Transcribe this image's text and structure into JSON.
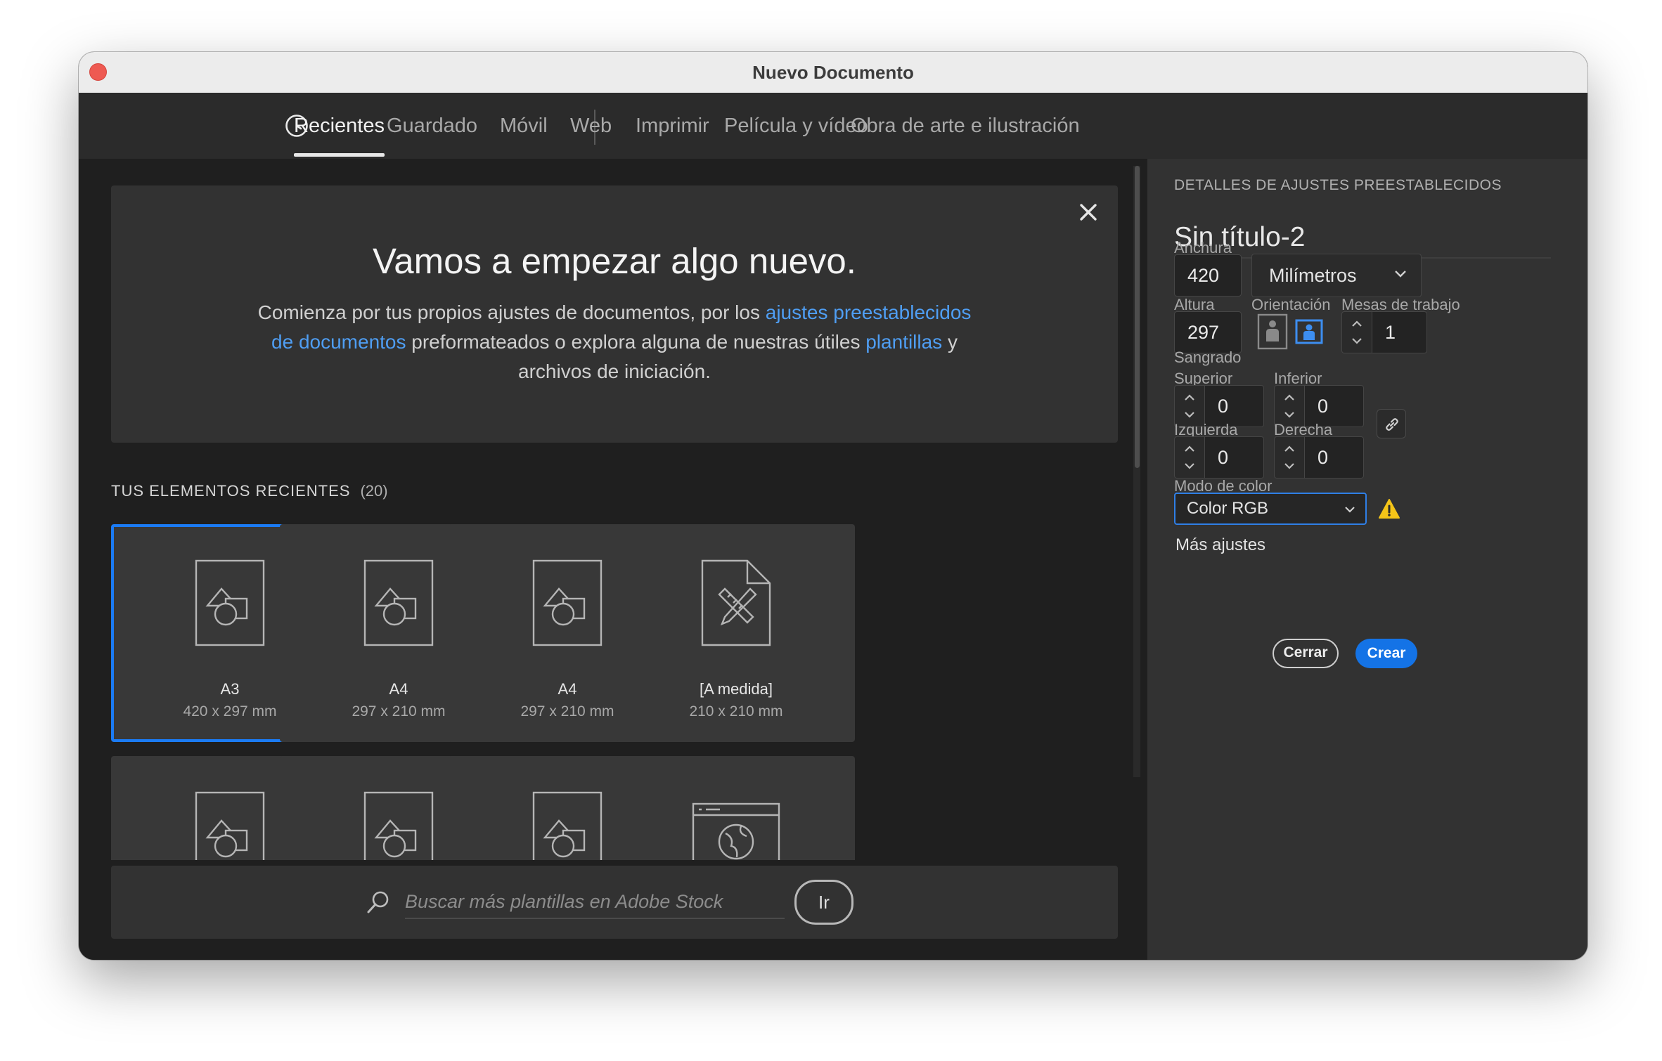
{
  "window": {
    "title": "Nuevo Documento"
  },
  "tabs": [
    {
      "label": "Recientes",
      "active": true
    },
    {
      "label": "Guardado"
    },
    {
      "label": "Móvil"
    },
    {
      "label": "Web"
    },
    {
      "label": "Imprimir"
    },
    {
      "label": "Película y vídeo"
    },
    {
      "label": "Obra de arte e ilustración"
    }
  ],
  "welcome": {
    "title": "Vamos a empezar algo nuevo.",
    "text_1": "Comienza por tus propios ajustes de documentos, por los ",
    "link_presets": "ajustes preestablecidos de documentos",
    "text_2": " preformateados o explora alguna de nuestras útiles ",
    "link_templates": "plantillas",
    "text_3": " y archivos de iniciación."
  },
  "recent": {
    "label": "TUS ELEMENTOS RECIENTES",
    "count": "(20)",
    "items": [
      {
        "name": "A3",
        "size": "420 x 297 mm",
        "icon": "shapes-document-icon",
        "selected": true
      },
      {
        "name": "A4",
        "size": "297 x 210 mm",
        "icon": "shapes-document-icon"
      },
      {
        "name": "A4",
        "size": "297 x 210 mm",
        "icon": "shapes-document-icon"
      },
      {
        "name": "[A medida]",
        "size": "210 x 210 mm",
        "icon": "pencil-ruler-document-icon"
      }
    ]
  },
  "search": {
    "placeholder": "Buscar más plantillas en Adobe Stock",
    "button": "Ir"
  },
  "details": {
    "header": "DETALLES DE AJUSTES PREESTABLECIDOS",
    "preset_name": "Sin título-2",
    "width_label": "Anchura",
    "width_value": "420",
    "units": "Milímetros",
    "height_label": "Altura",
    "height_value": "297",
    "orientation_label": "Orientación",
    "orientation_selected": "landscape",
    "artboards_label": "Mesas de trabajo",
    "artboards_value": "1",
    "bleed_label": "Sangrado",
    "top_label": "Superior",
    "top_value": "0",
    "bottom_label": "Inferior",
    "bottom_value": "0",
    "left_label": "Izquierda",
    "left_value": "0",
    "right_label": "Derecha",
    "right_value": "0",
    "color_mode_label": "Modo de color",
    "color_mode": "Color RGB",
    "more_settings": "Más ajustes",
    "close_button": "Cerrar",
    "create_button": "Crear"
  },
  "colors": {
    "accent": "#1473e6",
    "link": "#4f9ef3",
    "warning": "#f5c518"
  }
}
